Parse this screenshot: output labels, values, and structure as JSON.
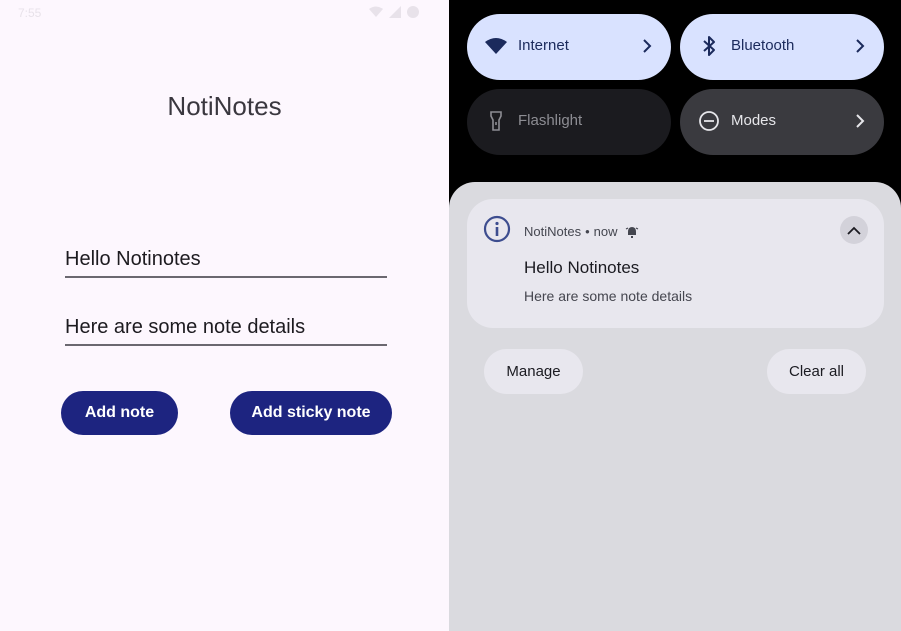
{
  "status_bar": {
    "time": "7:55"
  },
  "app": {
    "title": "NotiNotes",
    "title_field_value": "Hello Notinotes",
    "details_field_value": "Here are some note details",
    "add_note_label": "Add note",
    "add_sticky_note_label": "Add sticky note"
  },
  "quick_settings": {
    "tiles": [
      {
        "label": "Internet",
        "icon": "wifi-icon",
        "state": "on"
      },
      {
        "label": "Bluetooth",
        "icon": "bluetooth-icon",
        "state": "on"
      },
      {
        "label": "Flashlight",
        "icon": "flashlight-icon",
        "state": "off"
      },
      {
        "label": "Modes",
        "icon": "modes-icon",
        "state": "neutral"
      }
    ]
  },
  "notification": {
    "app_name": "NotiNotes",
    "separator": "•",
    "time": "now",
    "title": "Hello Notinotes",
    "body": "Here are some note details"
  },
  "shade_actions": {
    "manage_label": "Manage",
    "clear_all_label": "Clear all"
  },
  "colors": {
    "app_background": "#fdf7fe",
    "button_primary": "#1d2480",
    "tile_active": "#d9e2ff",
    "tile_inactive": "#1b1b1f",
    "tile_neutral": "#3a3a3f",
    "shade_background": "#dadadf",
    "notification_card": "#e8e7ee"
  }
}
